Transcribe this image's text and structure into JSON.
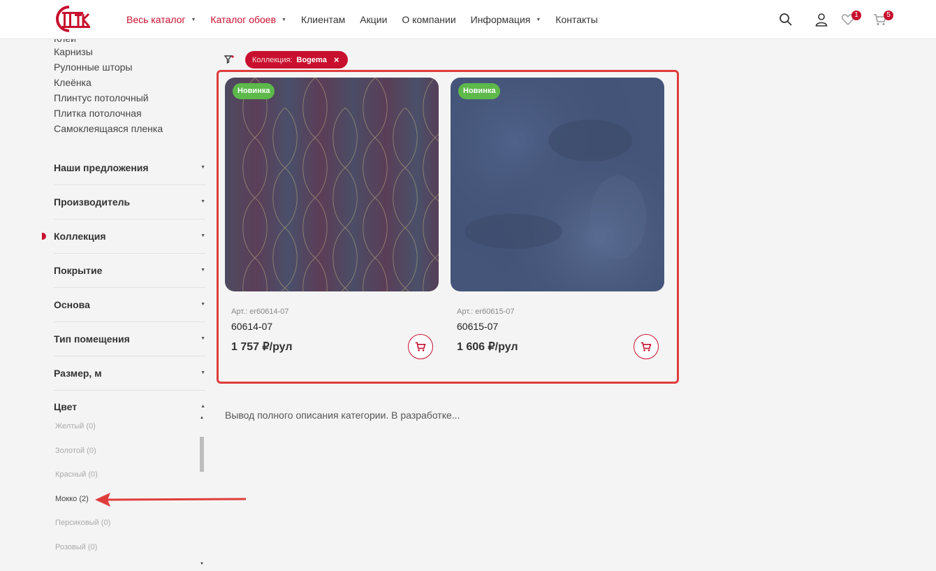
{
  "header": {
    "nav": [
      {
        "label": "Весь каталог",
        "red": true,
        "caret": true
      },
      {
        "label": "Каталог обоев",
        "red": true,
        "caret": true
      },
      {
        "label": "Клиентам",
        "red": false,
        "caret": false
      },
      {
        "label": "Акции",
        "red": false,
        "caret": false
      },
      {
        "label": "О компании",
        "red": false,
        "caret": false
      },
      {
        "label": "Информация",
        "red": false,
        "caret": true
      },
      {
        "label": "Контакты",
        "red": false,
        "caret": false
      }
    ],
    "favorites_count": "1",
    "cart_count": "5"
  },
  "sidebar": {
    "top_links": [
      "Клей",
      "Карнизы",
      "Рулонные шторы",
      "Клеёнка",
      "Плинтус потолочный",
      "Плитка потолочная",
      "Самоклеящаяся пленка"
    ],
    "sections": [
      {
        "label": "Наши предложения"
      },
      {
        "label": "Производитель"
      },
      {
        "label": "Коллекция"
      },
      {
        "label": "Покрытие"
      },
      {
        "label": "Основа"
      },
      {
        "label": "Тип помещения"
      },
      {
        "label": "Размер, м"
      },
      {
        "label": "Цвет"
      }
    ],
    "colors": [
      "Желтый (0)",
      "Золотой (0)",
      "Красный (0)",
      "Мокко (2)",
      "Персиковый (0)",
      "Розовый (0)"
    ]
  },
  "filter": {
    "key": "Коллекция:",
    "value": "Bogema",
    "remove": "×"
  },
  "products": [
    {
      "badge": "Новинка",
      "art": "Арт.: er60614-07",
      "name": "60614-07",
      "price": "1 757 ₽/рул"
    },
    {
      "badge": "Новинка",
      "art": "Арт.: er60615-07",
      "name": "60615-07",
      "price": "1 606 ₽/рул"
    }
  ],
  "description": "Вывод полного описания категории. В разработке...",
  "colors": {
    "accent": "#c8102e",
    "new_badge": "#5cb94a",
    "highlight": "#e03c3c"
  }
}
